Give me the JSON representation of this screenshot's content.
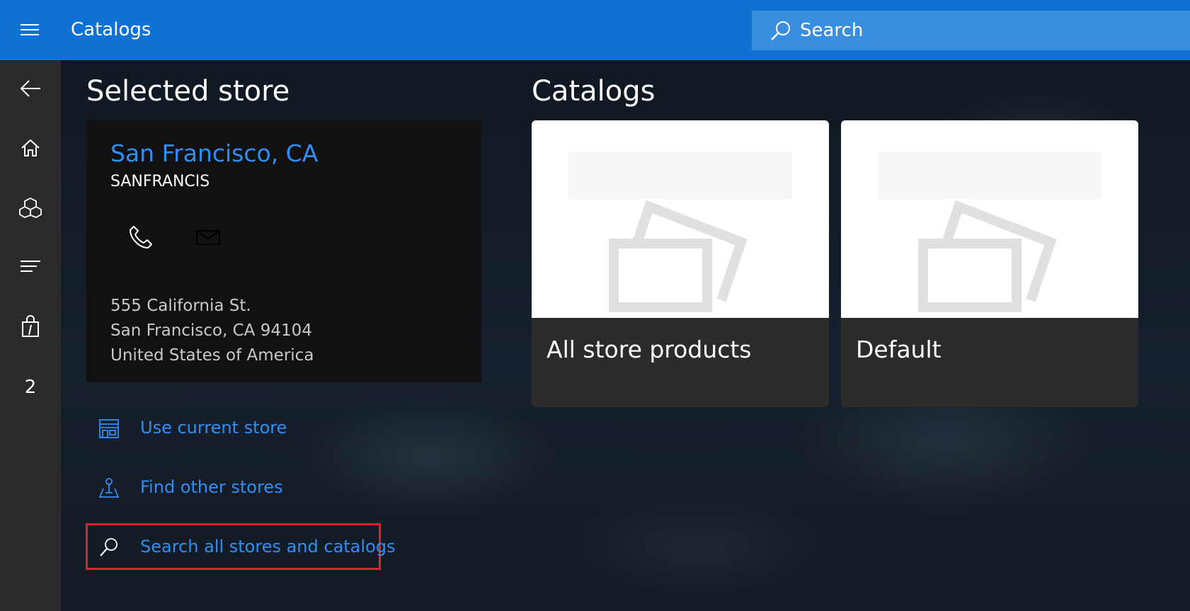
{
  "header": {
    "menu_icon": "hamburger-icon",
    "title": "Catalogs",
    "search": {
      "placeholder": "Search",
      "icon": "search-icon"
    }
  },
  "rail": {
    "items": [
      {
        "name": "back",
        "icon": "back-arrow-icon"
      },
      {
        "name": "home",
        "icon": "home-icon"
      },
      {
        "name": "products",
        "icon": "boxes-icon"
      },
      {
        "name": "menu-list",
        "icon": "list-icon"
      },
      {
        "name": "cart",
        "icon": "shopping-bag-icon"
      }
    ],
    "count_label": "2"
  },
  "selected_store": {
    "heading": "Selected store",
    "name": "San Francisco, CA",
    "code": "SANFRANCIS",
    "contact_icons": [
      "phone-icon",
      "mail-icon"
    ],
    "address": {
      "line1": "555 California St.",
      "line2": "San Francisco, CA 94104",
      "line3": "United States of America"
    }
  },
  "actions": {
    "use_current": {
      "label": "Use current store",
      "icon": "store-icon"
    },
    "find_other": {
      "label": "Find other stores",
      "icon": "map-pin-icon"
    },
    "search_all": {
      "label": "Search all stores and catalogs",
      "icon": "search-icon",
      "highlighted": true
    }
  },
  "catalogs": {
    "heading": "Catalogs",
    "items": [
      {
        "label": "All store products",
        "image_icon": "image-placeholder-icon"
      },
      {
        "label": "Default",
        "image_icon": "image-placeholder-icon"
      }
    ]
  },
  "colors": {
    "accent": "#1071d4",
    "link": "#2f8ff5",
    "highlight": "#e0202a"
  }
}
